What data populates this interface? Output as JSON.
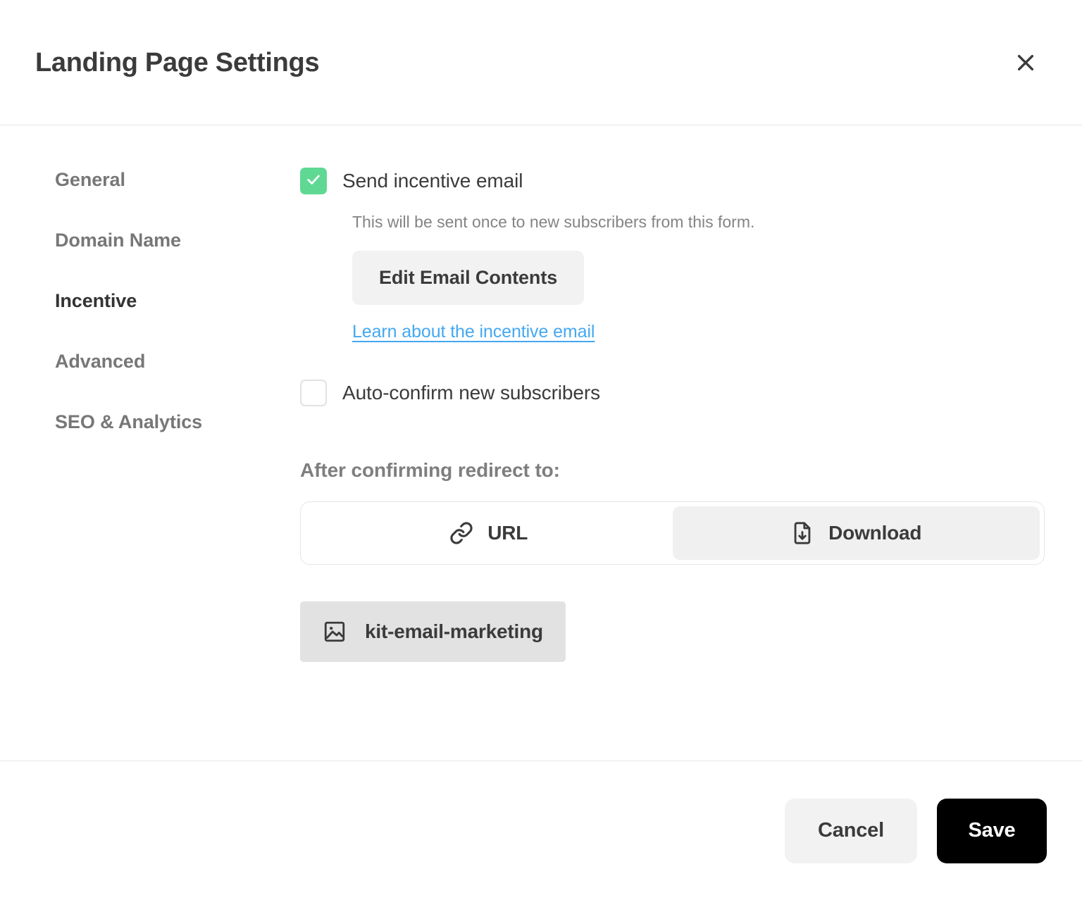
{
  "header": {
    "title": "Landing Page Settings",
    "close_icon": "close-icon"
  },
  "sidebar": {
    "items": [
      {
        "label": "General",
        "active": false
      },
      {
        "label": "Domain Name",
        "active": false
      },
      {
        "label": "Incentive",
        "active": true
      },
      {
        "label": "Advanced",
        "active": false
      },
      {
        "label": "SEO & Analytics",
        "active": false
      }
    ]
  },
  "main": {
    "incentive_email": {
      "checkbox_label": "Send incentive email",
      "checked": true,
      "check_icon": "check-icon",
      "help_text": "This will be sent once to new subscribers from this form.",
      "edit_button_label": "Edit Email Contents",
      "link_label": "Learn about the incentive email"
    },
    "auto_confirm": {
      "checkbox_label": "Auto-confirm new subscribers",
      "checked": false
    },
    "redirect": {
      "heading": "After confirming redirect to:",
      "options": [
        {
          "label": "URL",
          "icon": "link-icon",
          "selected": false
        },
        {
          "label": "Download",
          "icon": "file-download-icon",
          "selected": true
        }
      ],
      "selected_file": {
        "name": "kit-email-marketing",
        "icon": "image-icon"
      }
    }
  },
  "footer": {
    "cancel_label": "Cancel",
    "save_label": "Save"
  },
  "colors": {
    "accent_green": "#5fd894",
    "link_blue": "#44a8f2",
    "primary_button": "#000000",
    "muted_text": "#777777",
    "surface_gray": "#f2f2f2",
    "chip_gray": "#e2e2e2"
  }
}
